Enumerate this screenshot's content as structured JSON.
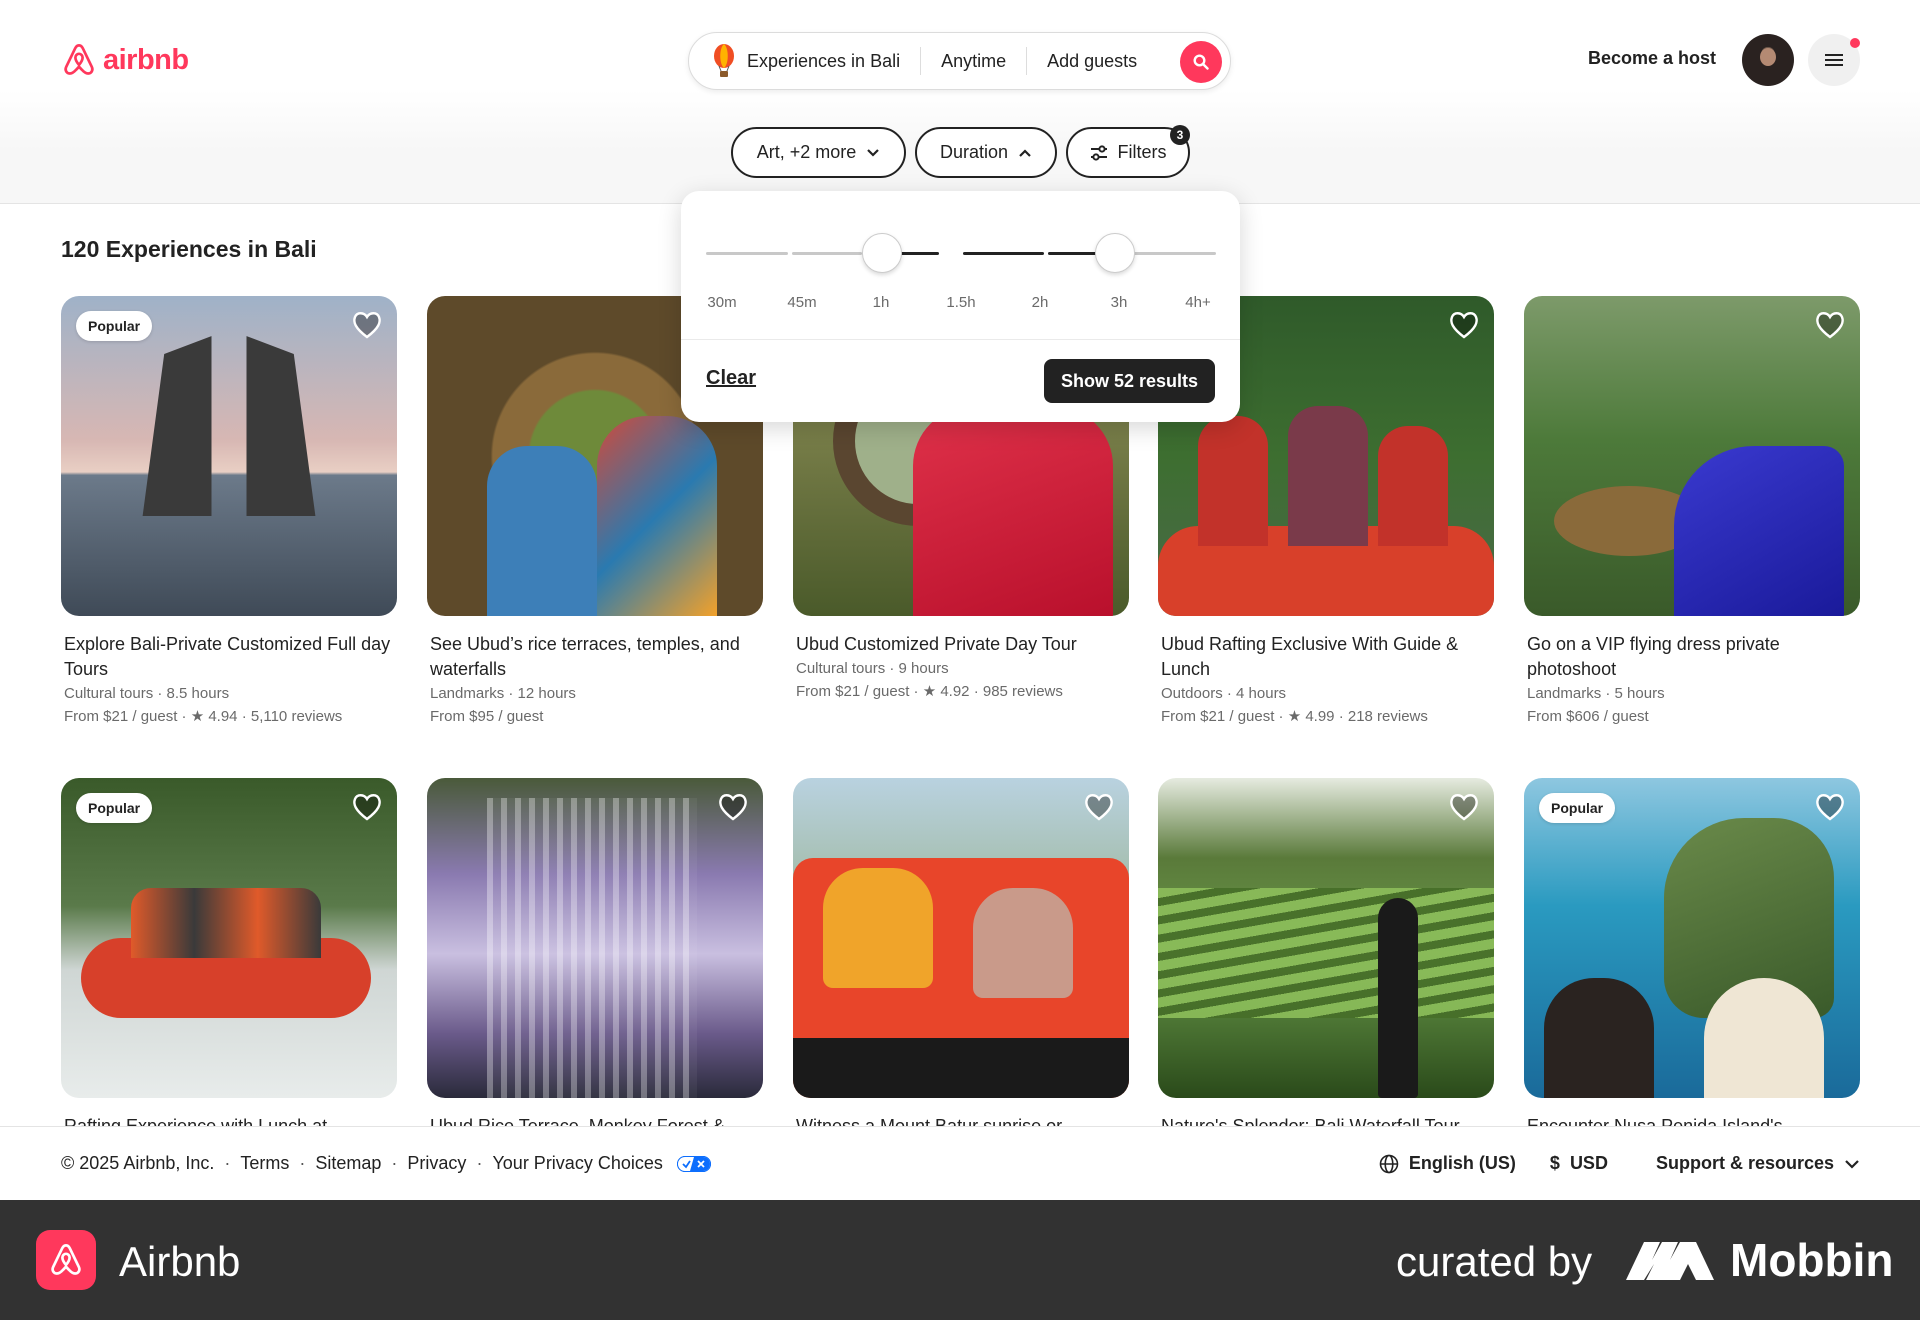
{
  "header": {
    "logo_text": "airbnb",
    "search": {
      "location": "Experiences in Bali",
      "dates": "Anytime",
      "guests": "Add guests"
    },
    "become_host": "Become a host",
    "notification_color": "#ff385c"
  },
  "filters": {
    "category": "Art, +2 more",
    "duration": "Duration",
    "filters": "Filters",
    "filters_count": "3"
  },
  "duration_popover": {
    "ticks": [
      "30m",
      "45m",
      "1h",
      "1.5h",
      "2h",
      "3h",
      "4h+"
    ],
    "selected_min": "1h",
    "selected_max": "3h",
    "clear_label": "Clear",
    "show_label": "Show 52 results"
  },
  "results": {
    "title": "120 Experiences in Bali",
    "cards": [
      {
        "badge": "Popular",
        "title": "Explore Bali-Private Customized Full day Tours",
        "meta1": "Cultural tours · 8.5 hours",
        "meta2": "From $21 / guest · ★ 4.94 · 5,110 reviews"
      },
      {
        "badge": "",
        "title": "See Ubud’s rice terraces, temples, and waterfalls",
        "meta1": "Landmarks · 12 hours",
        "meta2": "From $95 / guest"
      },
      {
        "badge": "",
        "title": "Ubud Customized Private Day Tour",
        "meta1": "Cultural tours · 9 hours",
        "meta2": "From $21 / guest · ★ 4.92 · 985 reviews"
      },
      {
        "badge": "",
        "title": "Ubud Rafting Exclusive With Guide & Lunch",
        "meta1": "Outdoors · 4 hours",
        "meta2": "From $21 / guest · ★ 4.99 · 218 reviews"
      },
      {
        "badge": "",
        "title": "Go on a VIP flying dress private photoshoot",
        "meta1": "Landmarks · 5 hours",
        "meta2": "From $606 / guest"
      },
      {
        "badge": "Popular",
        "title": "Rafting Experience with Lunch at",
        "meta1": "",
        "meta2": ""
      },
      {
        "badge": "",
        "title": "Ubud Rice Terrace, Monkey Forest &",
        "meta1": "",
        "meta2": ""
      },
      {
        "badge": "",
        "title": "Witness a Mount Batur sunrise or",
        "meta1": "",
        "meta2": ""
      },
      {
        "badge": "",
        "title": "Nature's Splendor: Bali Waterfall Tour",
        "meta1": "",
        "meta2": ""
      },
      {
        "badge": "Popular",
        "title": "Encounter Nusa Penida Island's",
        "meta1": "",
        "meta2": ""
      }
    ]
  },
  "footer": {
    "copyright": "© 2025 Airbnb, Inc.",
    "links": [
      "Terms",
      "Sitemap",
      "Privacy",
      "Your Privacy Choices"
    ],
    "language": "English (US)",
    "currency_symbol": "$",
    "currency": "USD",
    "support": "Support & resources"
  },
  "bottom_bar": {
    "app_name": "Airbnb",
    "curated": "curated by",
    "brand": "Mobbin"
  },
  "colors": {
    "brand": "#ff385c",
    "text": "#222222",
    "muted": "#6a6a6a"
  }
}
